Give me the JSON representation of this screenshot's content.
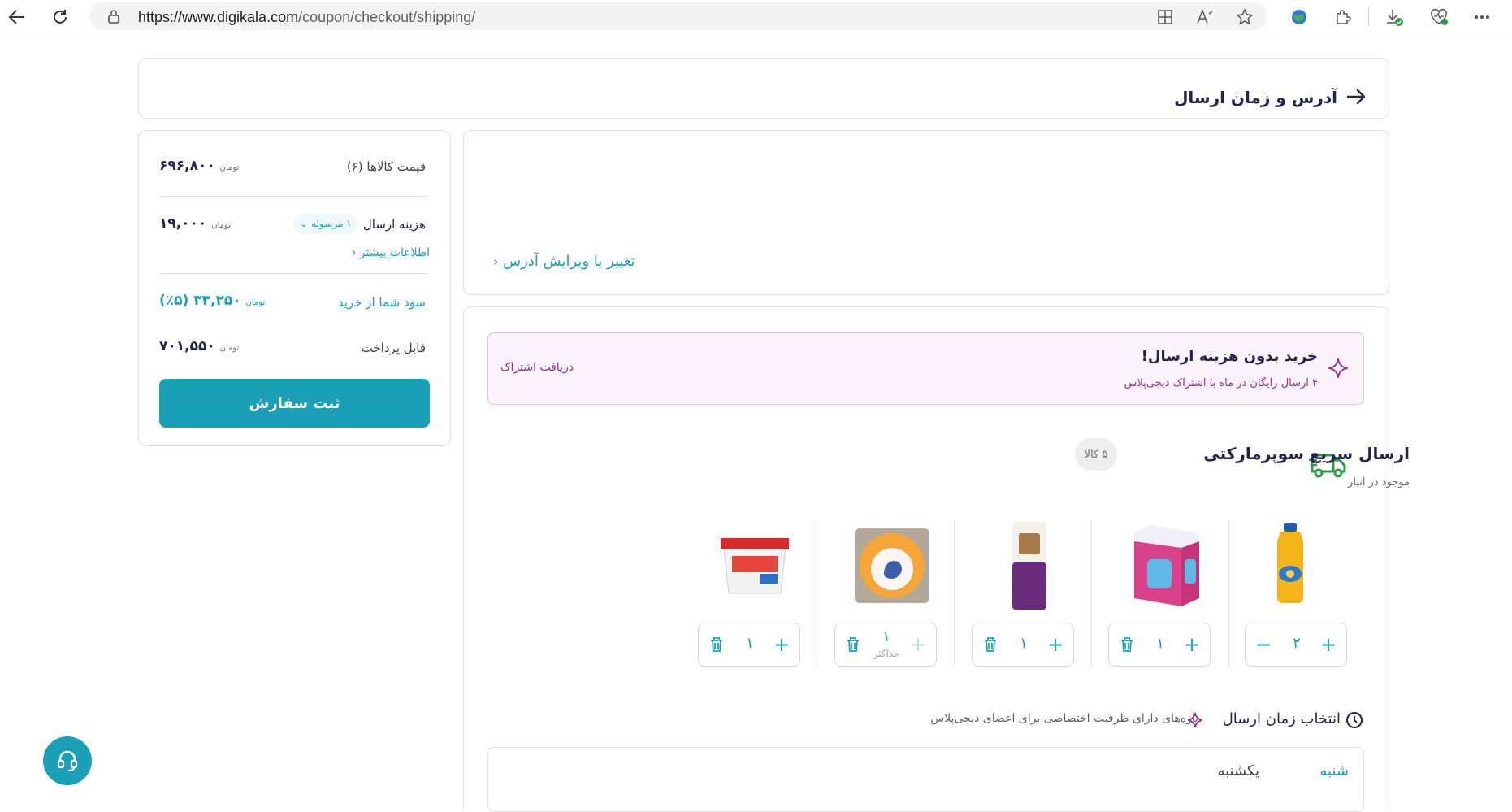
{
  "browser": {
    "url_prefix": "https://www.digikala.com",
    "url_path": "/coupon/checkout/shipping/"
  },
  "header": {
    "title": "آدرس و زمان ارسال"
  },
  "address": {
    "change_link": "تغییر یا ویرایش آدرس"
  },
  "promo": {
    "title": "خرید بدون هزینه ارسال!",
    "subtitle": "۴ ارسال رایگان در ماه با اشتراک دیجی‌پلاس",
    "cta": "دریافت اشتراک"
  },
  "shipment": {
    "title": "ارسال سریع سوپرمارکتی",
    "count_badge": "۵ کالا",
    "availability": "موجود در انبار",
    "items": [
      {
        "name": "cooking-oil",
        "qty": "۲",
        "max_label": "",
        "left_btn": "minus"
      },
      {
        "name": "milk-pack",
        "qty": "۱",
        "max_label": "",
        "left_btn": "trash"
      },
      {
        "name": "rice-bag",
        "qty": "۱",
        "max_label": "",
        "left_btn": "trash"
      },
      {
        "name": "eggs-tray",
        "qty": "۱",
        "max_label": "حداکثر",
        "left_btn": "trash"
      },
      {
        "name": "cheese-box",
        "qty": "۱",
        "max_label": "",
        "left_btn": "trash"
      }
    ]
  },
  "delivery_time": {
    "title": "انتخاب زمان ارسال",
    "note": "بازه‌های دارای ظرفیت اختصاصی برای اعضای دیجی‌پلاس",
    "days": [
      "شنبه",
      "یکشنبه"
    ]
  },
  "summary": {
    "items_price_label": "قیمت کالاها (۶)",
    "items_price_value": "۶۹۶,۸۰۰",
    "shipping_label": "هزینه ارسال",
    "shipping_pill": "۱ مرسوله",
    "shipping_value": "۱۹,۰۰۰",
    "more_info": "اطلاعات بیشتر",
    "profit_label": "سود شما از خرید",
    "profit_value": "۳۳,۲۵۰ (۵٪)",
    "payable_label": "قابل پرداخت",
    "payable_value": "۷۰۱,۵۵۰",
    "currency": "تومان",
    "submit_label": "ثبت سفارش"
  },
  "colors": {
    "accent": "#199fb6",
    "promo_purple": "#9c2c91",
    "text_dark": "#23254e"
  }
}
